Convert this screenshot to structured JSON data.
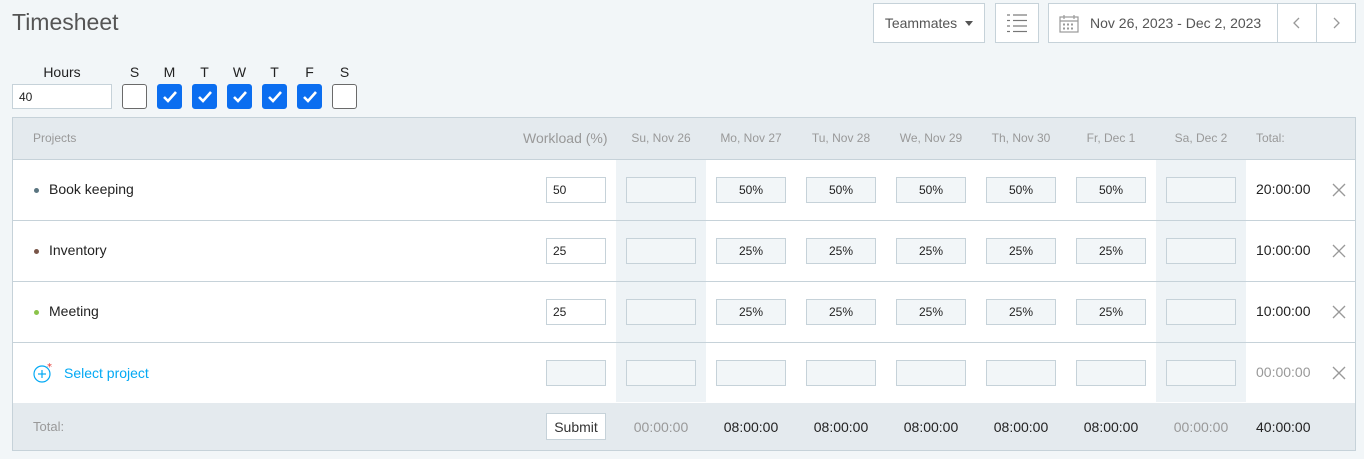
{
  "title": "Timesheet",
  "toolbar": {
    "teammates_label": "Teammates",
    "date_range": "Nov 26, 2023 - Dec 2, 2023"
  },
  "settings": {
    "hours_label": "Hours",
    "hours_value": "40",
    "days": [
      {
        "letter": "S",
        "checked": false
      },
      {
        "letter": "M",
        "checked": true
      },
      {
        "letter": "T",
        "checked": true
      },
      {
        "letter": "W",
        "checked": true
      },
      {
        "letter": "T",
        "checked": true
      },
      {
        "letter": "F",
        "checked": true
      },
      {
        "letter": "S",
        "checked": false
      }
    ]
  },
  "table": {
    "headers": {
      "projects": "Projects",
      "workload": "Workload (%)",
      "days": [
        "Su, Nov 26",
        "Mo, Nov 27",
        "Tu, Nov 28",
        "We, Nov 29",
        "Th, Nov 30",
        "Fr, Dec 1",
        "Sa, Dec 2"
      ],
      "total": "Total:"
    },
    "rows": [
      {
        "name": "Book keeping",
        "color": "#5a7580",
        "workload": "50",
        "days": [
          "",
          "50%",
          "50%",
          "50%",
          "50%",
          "50%",
          ""
        ],
        "total": "20:00:00"
      },
      {
        "name": "Inventory",
        "color": "#795548",
        "workload": "25",
        "days": [
          "",
          "25%",
          "25%",
          "25%",
          "25%",
          "25%",
          ""
        ],
        "total": "10:00:00"
      },
      {
        "name": "Meeting",
        "color": "#8bc34a",
        "workload": "25",
        "days": [
          "",
          "25%",
          "25%",
          "25%",
          "25%",
          "25%",
          ""
        ],
        "total": "10:00:00"
      }
    ],
    "new_row": {
      "select_label": "Select project",
      "total": "00:00:00"
    },
    "footer": {
      "total_label": "Total:",
      "submit_label": "Submit",
      "days": [
        "00:00:00",
        "08:00:00",
        "08:00:00",
        "08:00:00",
        "08:00:00",
        "08:00:00",
        "00:00:00"
      ],
      "total": "40:00:00"
    }
  },
  "colors": {
    "accent": "#03a9f4",
    "checkbox": "#0b6ef0",
    "border": "#c6d2d9",
    "header_bg": "#e4eaee"
  }
}
